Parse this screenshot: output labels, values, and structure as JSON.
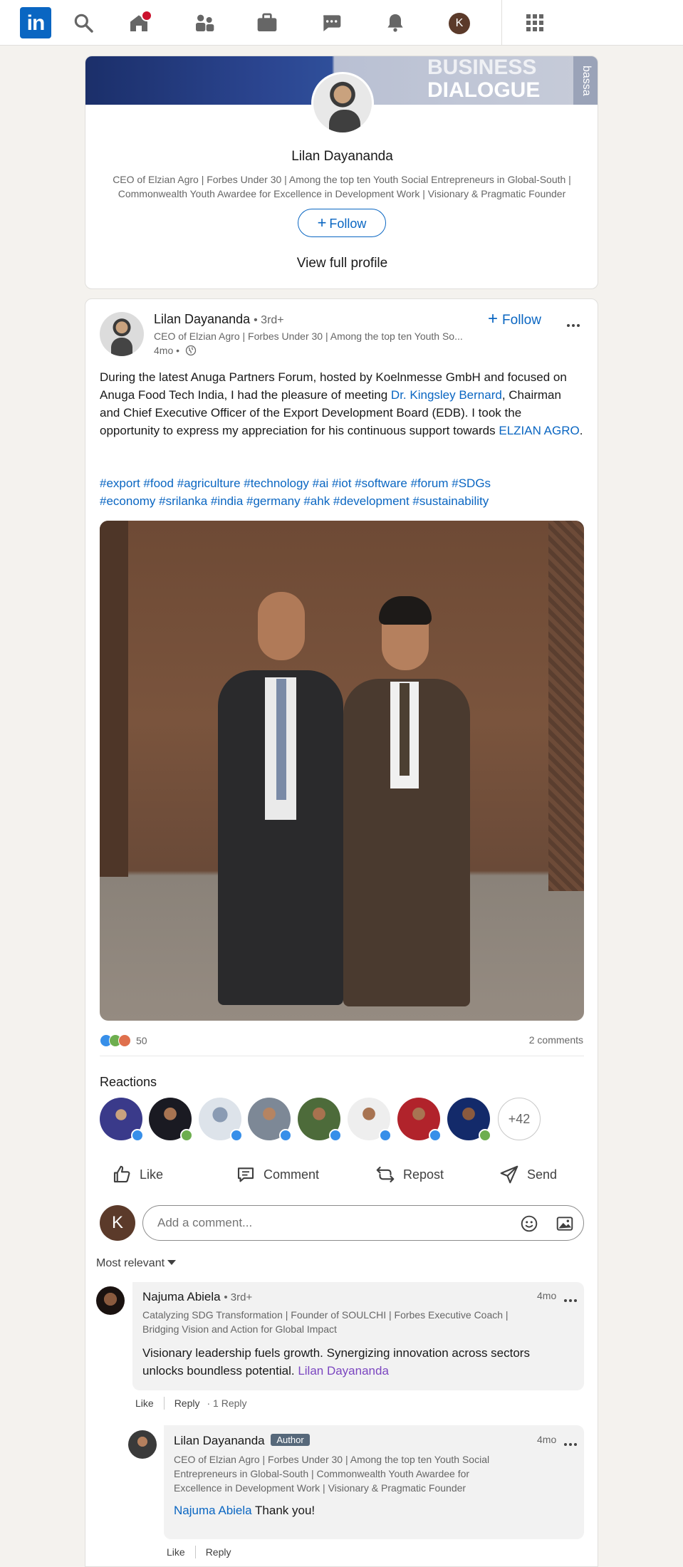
{
  "profile": {
    "name": "Lilan Dayananda",
    "headline": "CEO of Elzian Agro | Forbes Under 30 | Among the top ten Youth Social Entrepreneurs in Global-South | Commonwealth Youth Awardee for Excellence in Development Work | Visionary & Pragmatic Founder",
    "banner_text_1": "BUSINESS",
    "banner_text_2": "DIALOGUE",
    "banner_side_text": "bassa",
    "follow_label": "Follow",
    "view_profile_label": "View full profile"
  },
  "nav": {
    "logo_text": "in",
    "avatar_initial": "K"
  },
  "post": {
    "author_name": "Lilan Dayananda",
    "degree": "• 3rd+",
    "headline": "CEO of Elzian Agro | Forbes Under 30 | Among the top ten Youth So...",
    "time": "4mo •",
    "follow_label": "Follow",
    "body_1": "During the latest Anuga Partners Forum, hosted by Koelnmesse GmbH and focused on Anuga Food Tech India, I had the pleasure of meeting ",
    "body_mention": "Dr. Kingsley Bernard",
    "body_2": ", Chairman and Chief Executive Officer of the Export Development Board (EDB). I took the opportunity to express my appreciation for his continuous support towards ",
    "body_company": "ELZIAN AGRO",
    "body_3": ".",
    "hashtags_line1": "#export #food #agriculture #technology #ai #iot #software #forum #SDGs",
    "hashtags_line2": "#economy #srilanka #india #germany #ahk #development #sustainability",
    "reaction_count": "50",
    "comments_count": "2 comments",
    "reactions_title": "Reactions",
    "more_reactors": "+42"
  },
  "actions": {
    "like": "Like",
    "comment": "Comment",
    "repost": "Repost",
    "send": "Send"
  },
  "comment_box": {
    "avatar_initial": "K",
    "placeholder": "Add a comment..."
  },
  "sort_label": "Most relevant",
  "comments": [
    {
      "name": "Najuma Abiela",
      "degree": "• 3rd+",
      "headline_1": "Catalyzing SDG Transformation | Founder of SOULCHI | Forbes Executive Coach |",
      "headline_2": "Bridging Vision and Action for Global Impact",
      "time": "4mo",
      "text": "Visionary leadership fuels growth. Synergizing innovation across sectors unlocks boundless potential. ",
      "mention": "Lilan Dayananda",
      "like": "Like",
      "reply": "Reply",
      "reply_count": "· 1 Reply"
    },
    {
      "name": "Lilan Dayananda",
      "badge": "Author",
      "headline_1": "CEO of Elzian Agro | Forbes Under 30 | Among the top ten Youth Social",
      "headline_2": "Entrepreneurs in Global-South | Commonwealth Youth Awardee for",
      "headline_3": "Excellence in Development Work | Visionary & Pragmatic Founder",
      "time": "4mo",
      "mention": "Najuma Abiela",
      "text": " Thank you!",
      "like": "Like",
      "reply": "Reply"
    }
  ],
  "colors": {
    "brand": "#0a66c2",
    "page_bg": "#f4f2ee",
    "notification": "#cb112d",
    "author_badge": "#56687a"
  }
}
